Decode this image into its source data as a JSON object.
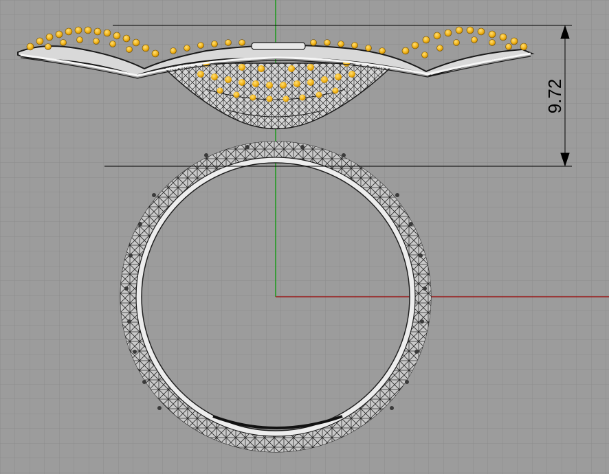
{
  "viewport": {
    "background": "#9c9c9c",
    "grid_minor_color": "#8c8c8c",
    "grid_major_color": "#7c7c7c",
    "x_axis_color": "#9a1a1a",
    "y_axis_color": "#1a9a1a"
  },
  "dimension": {
    "value_text": "9.72",
    "line_color": "#000000"
  },
  "model": {
    "wire_color": "#1a1a1a",
    "surface_color": "#d8d8d8",
    "highlight_color": "#f4f4f4",
    "gem_color": "#f2b418",
    "gem_shadow": "#b57b00"
  }
}
